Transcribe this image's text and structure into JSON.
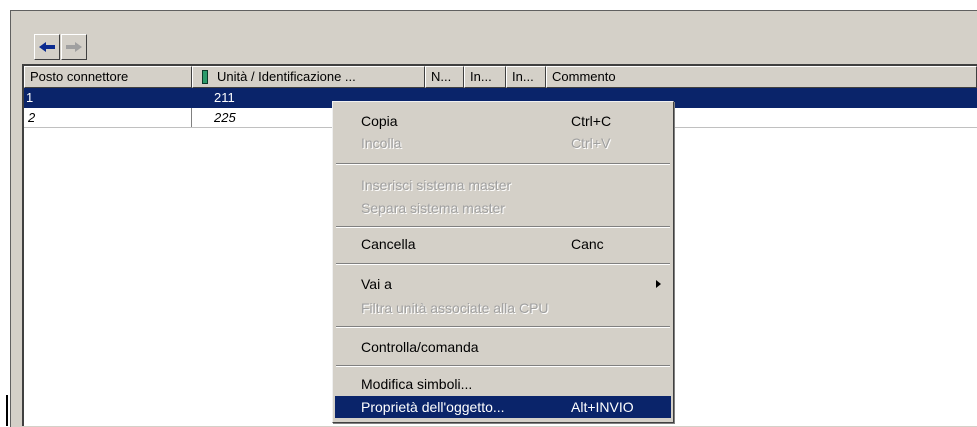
{
  "toolbar": {
    "back_icon": "arrow-left-icon",
    "forward_icon": "arrow-right-icon"
  },
  "table": {
    "columns": [
      "Posto connettore",
      "Unità / Identificazione ...",
      "N...",
      "In...",
      "In...",
      "Commento"
    ],
    "rows": [
      {
        "slot": "1",
        "unit": "211",
        "selected": true
      },
      {
        "slot": "2",
        "unit": "225",
        "selected": false
      }
    ]
  },
  "context_menu": {
    "items": [
      {
        "label": "Copia",
        "shortcut": "Ctrl+C",
        "enabled": true
      },
      {
        "label": "Incolla",
        "shortcut": "Ctrl+V",
        "enabled": false
      },
      {
        "label": "Inserisci sistema master",
        "enabled": false
      },
      {
        "label": "Separa sistema master",
        "enabled": false
      },
      {
        "label": "Cancella",
        "shortcut": "Canc",
        "enabled": true
      },
      {
        "label": "Vai a",
        "submenu": true,
        "enabled": true
      },
      {
        "label": "Filtra unità associate alla CPU",
        "enabled": false
      },
      {
        "label": "Controlla/comanda",
        "enabled": true
      },
      {
        "label": "Modifica simboli...",
        "enabled": true
      },
      {
        "label": "Proprietà dell'oggetto...",
        "shortcut": "Alt+INVIO",
        "enabled": true,
        "highlighted": true
      }
    ]
  },
  "colors": {
    "selection": "#0a246a",
    "window_face": "#d4d0c8",
    "arrow_active": "#0b2b8f",
    "arrow_disabled": "#a0a0a0"
  }
}
